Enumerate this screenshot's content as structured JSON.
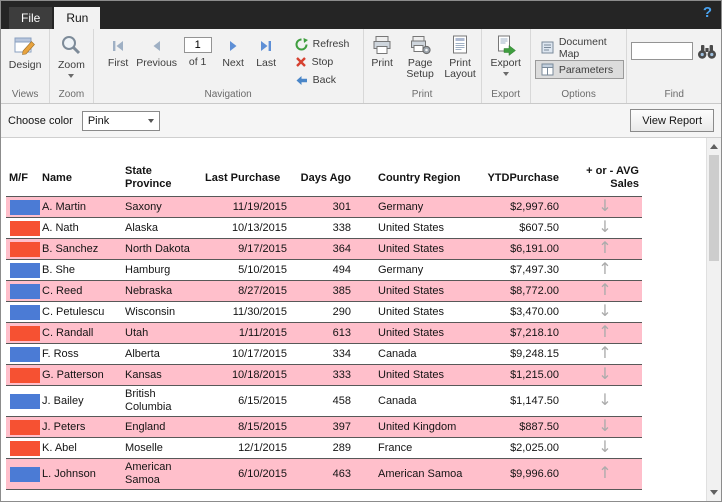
{
  "titlebar": {
    "help_label": "?",
    "tabs": [
      {
        "label": "File"
      },
      {
        "label": "Run"
      }
    ]
  },
  "ribbon": {
    "views": {
      "label": "Views",
      "design": "Design"
    },
    "zoom": {
      "label": "Zoom",
      "zoom": "Zoom"
    },
    "navigation": {
      "label": "Navigation",
      "first": "First",
      "previous": "Previous",
      "next": "Next",
      "last": "Last",
      "page_value": "1",
      "of_label": "of 1",
      "refresh": "Refresh",
      "stop": "Stop",
      "back": "Back"
    },
    "print": {
      "label": "Print",
      "print": "Print",
      "page_setup": "Page Setup",
      "print_layout": "Print Layout"
    },
    "export": {
      "label": "Export",
      "export": "Export"
    },
    "options": {
      "label": "Options",
      "document_map": "Document Map",
      "parameters": "Parameters"
    },
    "find": {
      "label": "Find"
    }
  },
  "parameters_bar": {
    "choose_color_label": "Choose color",
    "selected_color": "Pink",
    "view_report_label": "View Report"
  },
  "report": {
    "columns": [
      {
        "id": "mf",
        "label": "M/F"
      },
      {
        "id": "name",
        "label": "Name"
      },
      {
        "id": "state",
        "label": "State Province"
      },
      {
        "id": "last",
        "label": "Last Purchase"
      },
      {
        "id": "days",
        "label": "Days Ago"
      },
      {
        "id": "country",
        "label": "Country Region"
      },
      {
        "id": "ytd",
        "label": "YTDPurchase"
      },
      {
        "id": "trend",
        "label": "+ or - AVG Sales"
      }
    ],
    "rows": [
      {
        "shaded": true,
        "mf": "blue",
        "name": "A. Martin",
        "state": "Saxony",
        "last": "11/19/2015",
        "days": "301",
        "country": "Germany",
        "ytd": "$2,997.60",
        "trend": "down"
      },
      {
        "shaded": false,
        "mf": "red",
        "name": "A. Nath",
        "state": "Alaska",
        "last": "10/13/2015",
        "days": "338",
        "country": "United States",
        "ytd": "$607.50",
        "trend": "down"
      },
      {
        "shaded": true,
        "mf": "red",
        "name": "B. Sanchez",
        "state": "North Dakota",
        "last": "9/17/2015",
        "days": "364",
        "country": "United States",
        "ytd": "$6,191.00",
        "trend": "up"
      },
      {
        "shaded": false,
        "mf": "blue",
        "name": "B. She",
        "state": "Hamburg",
        "last": "5/10/2015",
        "days": "494",
        "country": "Germany",
        "ytd": "$7,497.30",
        "trend": "up"
      },
      {
        "shaded": true,
        "mf": "blue",
        "name": "C. Reed",
        "state": "Nebraska",
        "last": "8/27/2015",
        "days": "385",
        "country": "United States",
        "ytd": "$8,772.00",
        "trend": "up"
      },
      {
        "shaded": false,
        "mf": "blue",
        "name": "C. Petulescu",
        "state": "Wisconsin",
        "last": "11/30/2015",
        "days": "290",
        "country": "United States",
        "ytd": "$3,470.00",
        "trend": "down"
      },
      {
        "shaded": true,
        "mf": "red",
        "name": "C. Randall",
        "state": "Utah",
        "last": "1/11/2015",
        "days": "613",
        "country": "United States",
        "ytd": "$7,218.10",
        "trend": "up"
      },
      {
        "shaded": false,
        "mf": "blue",
        "name": "F. Ross",
        "state": "Alberta",
        "last": "10/17/2015",
        "days": "334",
        "country": "Canada",
        "ytd": "$9,248.15",
        "trend": "up"
      },
      {
        "shaded": true,
        "mf": "red",
        "name": "G. Patterson",
        "state": "Kansas",
        "last": "10/18/2015",
        "days": "333",
        "country": "United States",
        "ytd": "$1,215.00",
        "trend": "down"
      },
      {
        "shaded": false,
        "mf": "blue",
        "name": "J. Bailey",
        "state": "British Columbia",
        "last": "6/15/2015",
        "days": "458",
        "country": "Canada",
        "ytd": "$1,147.50",
        "trend": "down"
      },
      {
        "shaded": true,
        "mf": "red",
        "name": "J. Peters",
        "state": "England",
        "last": "8/15/2015",
        "days": "397",
        "country": "United Kingdom",
        "ytd": "$887.50",
        "trend": "down"
      },
      {
        "shaded": false,
        "mf": "red",
        "name": "K. Abel",
        "state": "Moselle",
        "last": "12/1/2015",
        "days": "289",
        "country": "France",
        "ytd": "$2,025.00",
        "trend": "down"
      },
      {
        "shaded": true,
        "mf": "blue",
        "name": "L. Johnson",
        "state": "American Samoa",
        "last": "6/10/2015",
        "days": "463",
        "country": "American Samoa",
        "ytd": "$9,996.60",
        "trend": "up"
      }
    ]
  },
  "icons": {
    "up_arrow": "↑",
    "down_arrow": "↓"
  },
  "colors": {
    "male_blue": "#4B7BD5",
    "female_red": "#F65132",
    "row_pink": "#FFBFCB"
  }
}
